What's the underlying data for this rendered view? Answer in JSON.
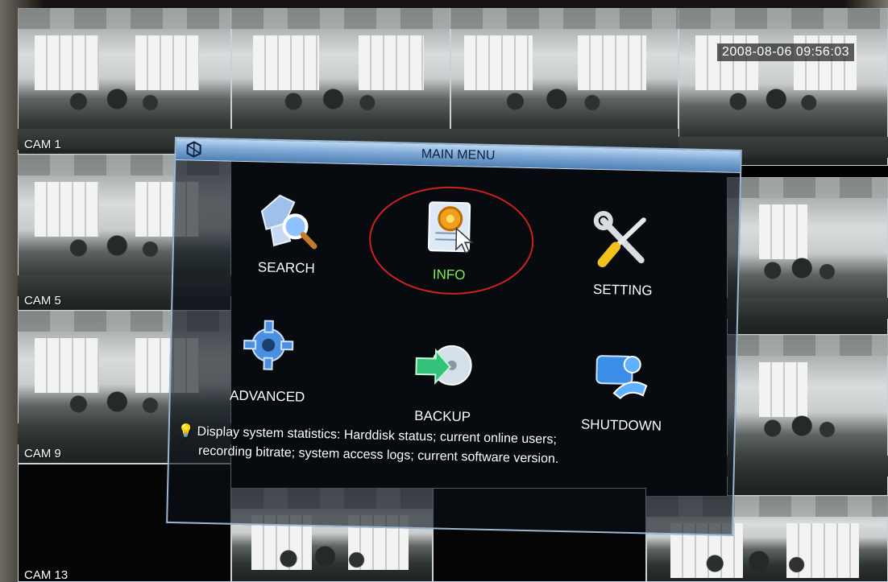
{
  "screen": {
    "timestamp": "2008-08-06 09:56:03"
  },
  "cameras": [
    {
      "label": "CAM 1"
    },
    {
      "label": "CAM 5"
    },
    {
      "label": "CAM 9"
    },
    {
      "label": "CAM 13"
    }
  ],
  "menu": {
    "title": "MAIN MENU",
    "items": [
      {
        "label": "SEARCH",
        "icon": "search-icon"
      },
      {
        "label": "INFO",
        "icon": "info-gear-icon",
        "active": true
      },
      {
        "label": "SETTING",
        "icon": "tools-icon"
      },
      {
        "label": "ADVANCED",
        "icon": "gear-icon"
      },
      {
        "label": "BACKUP",
        "icon": "disc-backup-icon"
      },
      {
        "label": "SHUTDOWN",
        "icon": "shutdown-person-icon"
      }
    ],
    "hint_line1": "Display system statistics: Harddisk status; current online users;",
    "hint_line2": "recording bitrate; system access logs; current software version."
  },
  "colors": {
    "active_label": "#7cf24a",
    "title_bar": "#7fa9d6",
    "highlight_ring": "#d21f1f"
  }
}
